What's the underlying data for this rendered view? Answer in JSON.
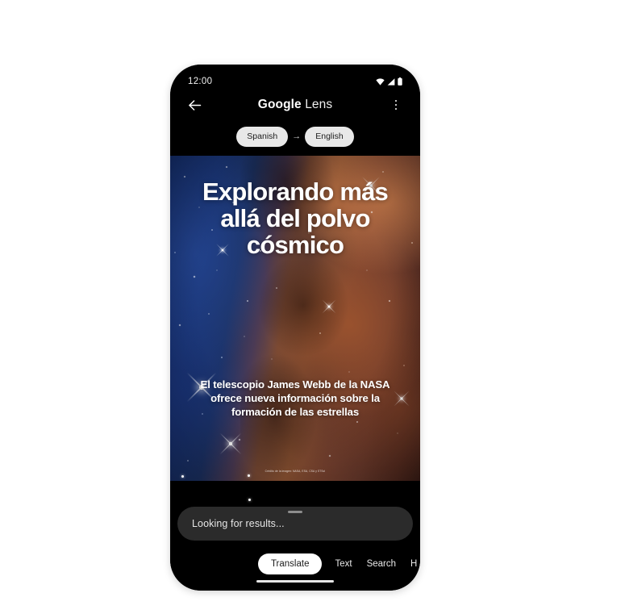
{
  "device": {
    "status_bar": {
      "time": "12:00",
      "icons": [
        "wifi-icon",
        "cellular-signal-icon",
        "battery-icon"
      ]
    },
    "gesture_bar": "home-indicator"
  },
  "app_bar": {
    "back_icon": "back-arrow-icon",
    "title_brand": "Google",
    "title_sub": " Lens",
    "overflow_icon": "more-vertical-icon"
  },
  "translate_bar": {
    "source_language": "Spanish",
    "arrow": "→",
    "target_language": "English"
  },
  "photo": {
    "alt_name": "carina-nebula-cosmic-cliffs",
    "headline": "Explorando más allá del polvo cósmico",
    "body": "El telescopio James Webb de la NASA ofrece nueva información sobre la formación de las estrellas",
    "credit": "Crédito de la imagen: NASA, ESA, CSA y STScI"
  },
  "bottom_sheet": {
    "handle": "drag-handle",
    "status_text": "Looking for results..."
  },
  "modes": [
    {
      "label": "Translate",
      "active": true
    },
    {
      "label": "Text",
      "active": false
    },
    {
      "label": "Search",
      "active": false
    },
    {
      "label": "H",
      "active": false
    }
  ],
  "colors": {
    "page_background": "#ffffff",
    "phone_body": "#0a0a0a",
    "screen": "#000000",
    "chip_background": "#e8e8e8",
    "chip_text": "#1c1c1c",
    "sheet_background": "#2b2b2b",
    "active_tab_background": "#ffffff",
    "active_tab_text": "#1b1b1b",
    "text_primary": "#ffffff"
  }
}
